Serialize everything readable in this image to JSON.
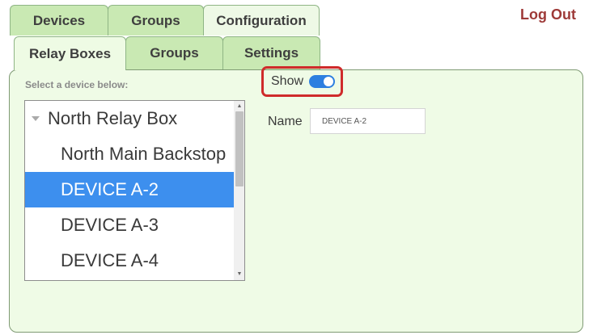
{
  "nav": {
    "top_tabs": [
      {
        "label": "Devices",
        "active": false
      },
      {
        "label": "Groups",
        "active": false
      },
      {
        "label": "Configuration",
        "active": true
      }
    ],
    "sub_tabs": [
      {
        "label": "Relay Boxes",
        "active": true
      },
      {
        "label": "Groups",
        "active": false
      },
      {
        "label": "Settings",
        "active": false
      }
    ],
    "logout_label": "Log Out"
  },
  "device_list": {
    "prompt": "Select a device below:",
    "group_label": "North Relay Box",
    "items": [
      {
        "label": "North Main Backstop",
        "selected": false
      },
      {
        "label": "DEVICE A-2",
        "selected": true
      },
      {
        "label": "DEVICE A-3",
        "selected": false
      },
      {
        "label": "DEVICE A-4",
        "selected": false
      }
    ]
  },
  "detail": {
    "show_label": "Show",
    "show_enabled": true,
    "name_label": "Name",
    "name_value": "DEVICE A-2"
  },
  "colors": {
    "tab_bg": "#c9e9b3",
    "panel_bg": "#effbe6",
    "selected_bg": "#3d8fee",
    "toggle_on": "#2d7fe0",
    "highlight_border": "#cf2b2b",
    "logout": "#9e3a38"
  }
}
